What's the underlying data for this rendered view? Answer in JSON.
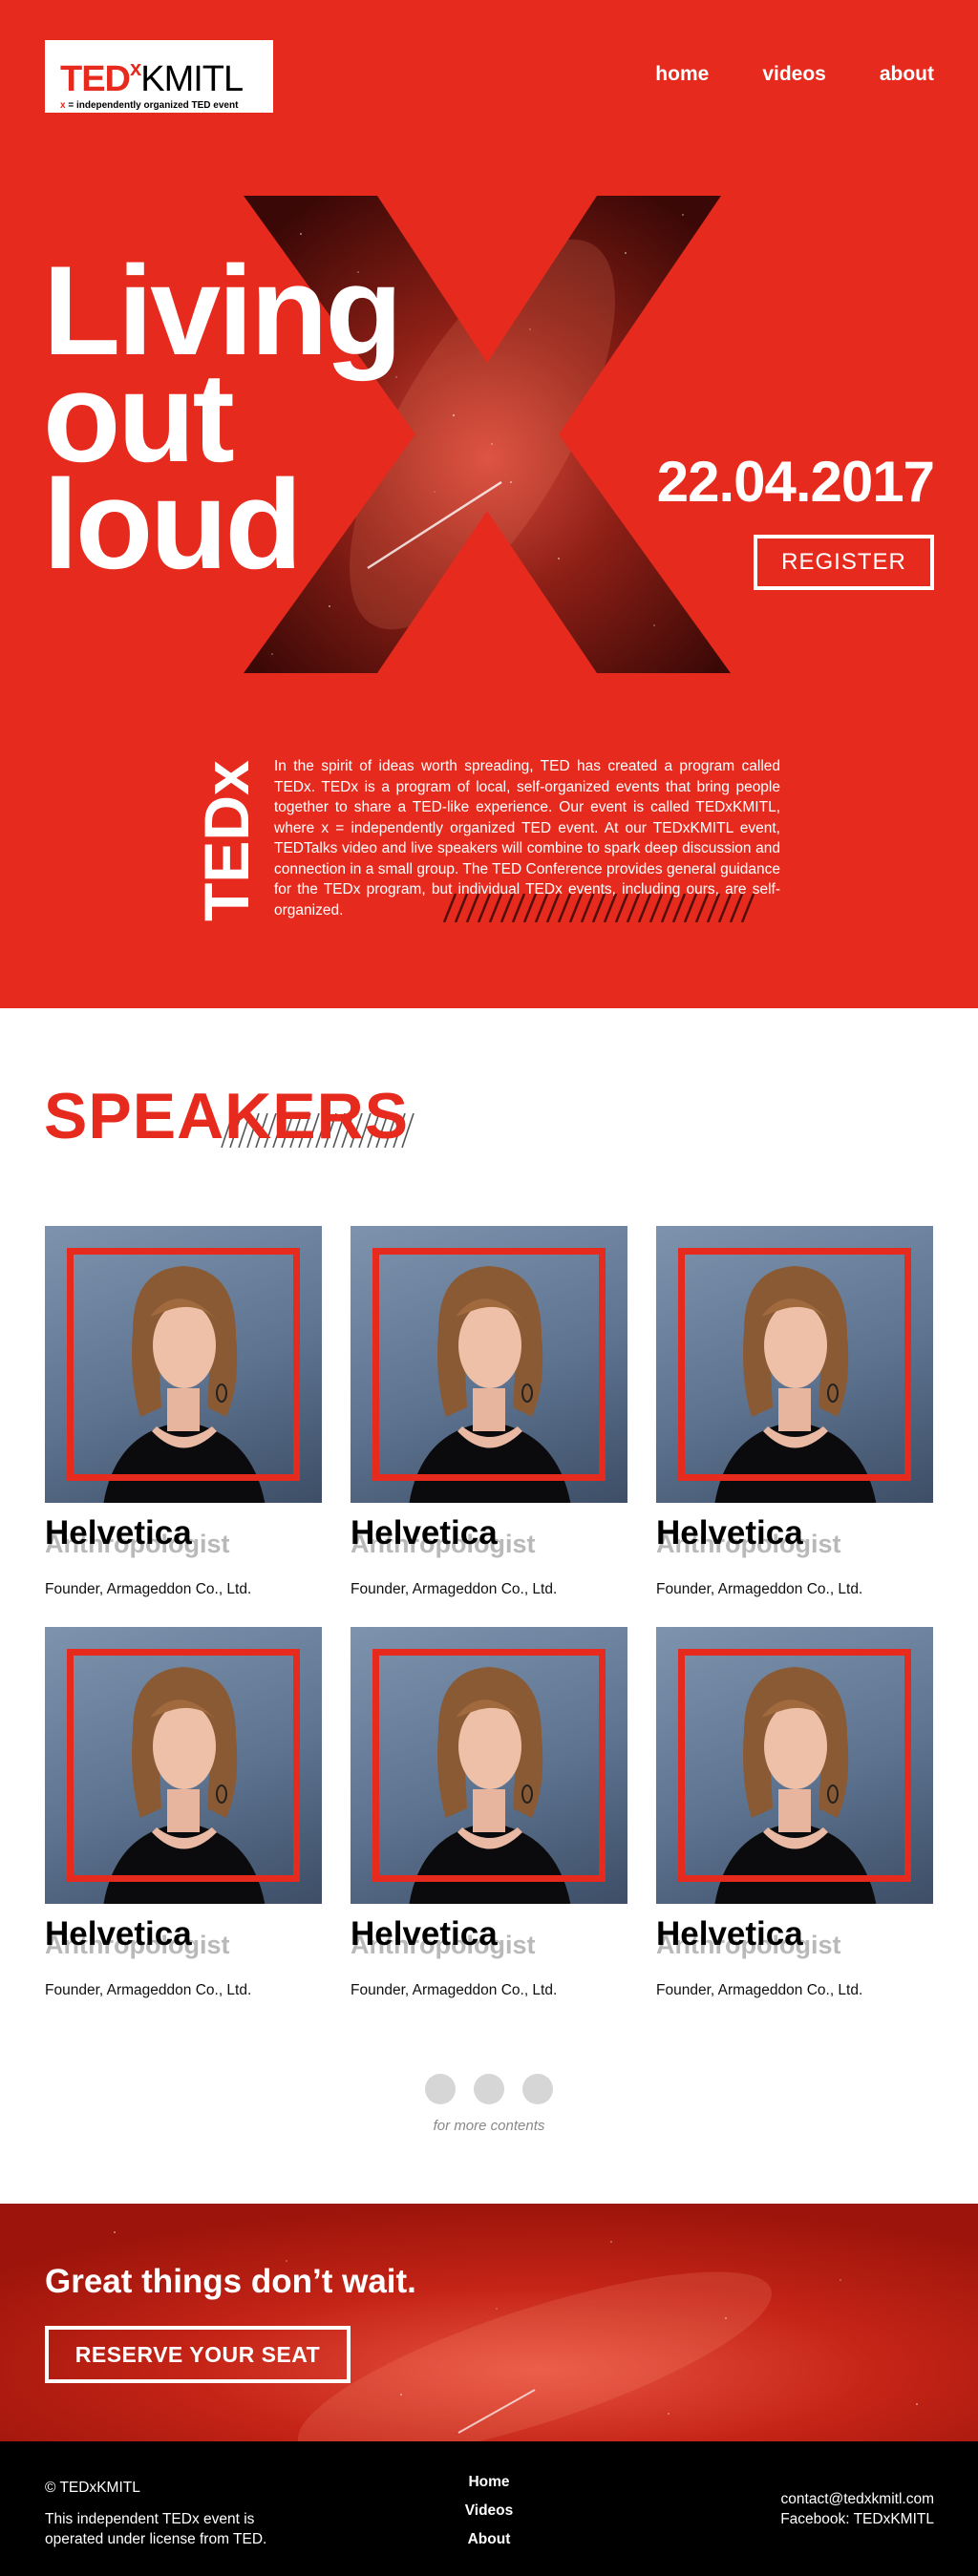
{
  "header": {
    "logo": {
      "ted": "TED",
      "x": "x",
      "name": "KMITL",
      "tagline_x": "x",
      "tagline": " = independently organized TED event"
    },
    "nav": [
      "home",
      "videos",
      "about"
    ]
  },
  "hero": {
    "title_lines": [
      "Living",
      "out",
      "loud"
    ],
    "date": "22.04.2017",
    "register_label": "REGISTER",
    "vertical_logo": "TEDx",
    "about": "In the spirit of ideas worth spreading, TED has created a program called TEDx. TEDx is a program of local, self-organized events that bring people together to share a TED-like experience. Our event is called TEDxKMITL, where x = independently organized TED event. At our TEDxKMITL event, TEDTalks video and live speakers will combine to spark deep discussion and connection in a small group. The TED Conference provides general guidance for the TEDx program, but individual TEDx events, including ours, are self-organized."
  },
  "speakers": {
    "title": "SPEAKERS",
    "items": [
      {
        "name": "Helvetica",
        "role": "Anthropologist",
        "company": "Founder, Armageddon Co., Ltd."
      },
      {
        "name": "Helvetica",
        "role": "Anthropologist",
        "company": "Founder, Armageddon Co., Ltd."
      },
      {
        "name": "Helvetica",
        "role": "Anthropologist",
        "company": "Founder, Armageddon Co., Ltd."
      },
      {
        "name": "Helvetica",
        "role": "Anthropologist",
        "company": "Founder, Armageddon Co., Ltd."
      },
      {
        "name": "Helvetica",
        "role": "Anthropologist",
        "company": "Founder, Armageddon Co., Ltd."
      },
      {
        "name": "Helvetica",
        "role": "Anthropologist",
        "company": "Founder, Armageddon Co., Ltd."
      }
    ],
    "more_label": "for more contents"
  },
  "cta": {
    "title": "Great things don’t wait.",
    "button": "RESERVE YOUR SEAT"
  },
  "footer": {
    "copyright": "© TEDxKMITL",
    "license": "This independent TEDx event is operated under license from TED.",
    "nav": [
      "Home",
      "Videos",
      "About"
    ],
    "email": "contact@tedxkmitl.com",
    "facebook": "Facebook: TEDxKMITL"
  },
  "colors": {
    "brand_red": "#e62b1e",
    "dark_red": "#c01f14",
    "footer_bg": "#000000",
    "muted_gray": "#b9b9b9"
  },
  "icons": [
    "tedx-logo",
    "big-x-graphic",
    "slash-hatch",
    "pagination-dot"
  ]
}
